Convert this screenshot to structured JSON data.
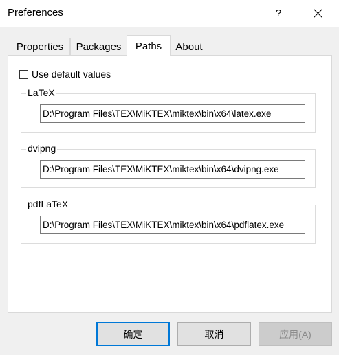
{
  "window": {
    "title": "Preferences",
    "help_glyph": "?"
  },
  "tabs": [
    {
      "label": "Properties",
      "active": false
    },
    {
      "label": "Packages",
      "active": false
    },
    {
      "label": "Paths",
      "active": true
    },
    {
      "label": "About",
      "active": false
    }
  ],
  "paths_panel": {
    "use_default": {
      "label": "Use default values",
      "checked": false
    },
    "groups": [
      {
        "legend": "LaTeX",
        "value": "D:\\Program Files\\TEX\\MiKTEX\\miktex\\bin\\x64\\latex.exe"
      },
      {
        "legend": "dvipng",
        "value": "D:\\Program Files\\TEX\\MiKTEX\\miktex\\bin\\x64\\dvipng.exe"
      },
      {
        "legend": "pdfLaTeX",
        "value": "D:\\Program Files\\TEX\\MiKTEX\\miktex\\bin\\x64\\pdflatex.exe"
      }
    ]
  },
  "buttons": {
    "ok": "确定",
    "cancel": "取消",
    "apply": "应用(A)",
    "apply_enabled": false
  },
  "colors": {
    "accent": "#0078d7",
    "window_bg": "#f0f0f0",
    "disabled_text": "#8c8c8c"
  }
}
